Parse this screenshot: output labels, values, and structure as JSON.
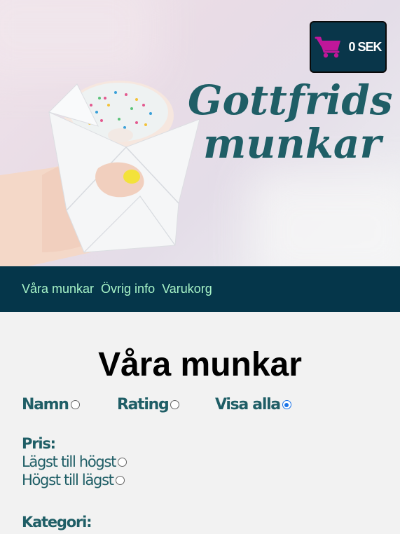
{
  "header": {
    "brand_line1": "Gottfrids",
    "brand_line2": "munkar",
    "cart_total": "0 SEK",
    "cart_icon": "shopping-cart-icon",
    "cart_icon_color": "#c0179a"
  },
  "nav": {
    "items": [
      {
        "label": "Våra munkar"
      },
      {
        "label": "Övrig info"
      },
      {
        "label": "Varukorg"
      }
    ]
  },
  "main": {
    "title": "Våra munkar",
    "sort_options": [
      {
        "label": "Namn",
        "checked": false
      },
      {
        "label": "Rating",
        "checked": false
      },
      {
        "label": "Visa alla",
        "checked": true
      }
    ],
    "price": {
      "heading": "Pris:",
      "options": [
        {
          "label": "Lägst till högst",
          "checked": false
        },
        {
          "label": "Högst till lägst",
          "checked": false
        }
      ]
    },
    "category": {
      "heading": "Kategori:"
    }
  },
  "colors": {
    "nav_bg": "#05364a",
    "nav_text": "#a7f3c7",
    "brand": "#1f5e66",
    "label_text": "#1f5e66",
    "cart_bg": "#09364a"
  }
}
